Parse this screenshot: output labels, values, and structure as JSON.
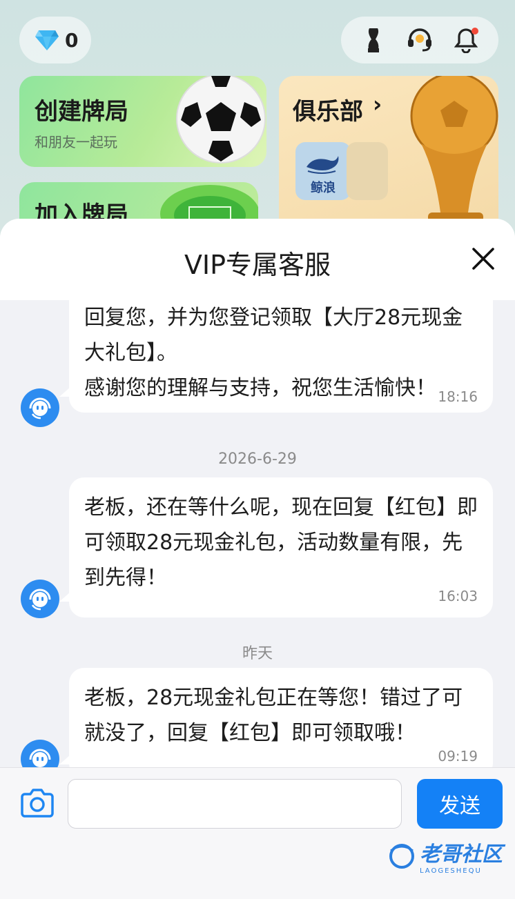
{
  "background": {
    "diamond_count": "0",
    "cards": {
      "create_title": "创建牌局",
      "create_subtitle": "和朋友一起玩",
      "join_title": "加入牌局",
      "club_title": "俱乐部",
      "club_chevron": "›",
      "club_logo_label": "鲸浪"
    },
    "toolbar_icons": [
      "trophy-icon",
      "headset-icon",
      "bell-icon"
    ]
  },
  "modal": {
    "title": "VIP专属客服",
    "close_icon": "close-icon"
  },
  "chat": {
    "messages": [
      {
        "text": "回复您，并为您登记领取【大厅28元现金大礼包】。\n感谢您的理解与支持，祝您生活愉快！",
        "time": "18:16"
      },
      {
        "date": "2026-6-29",
        "text": "老板，还在等什么呢，现在回复【红包】即可领取28元现金礼包，活动数量有限，先到先得！",
        "time": "16:03"
      },
      {
        "date": "昨天",
        "text": "老板，28元现金礼包正在等您！错过了可就没了，回复【红包】即可领取哦！",
        "time": "09:19"
      }
    ]
  },
  "input": {
    "placeholder": "",
    "value": "",
    "send_label": "发送"
  },
  "watermark": {
    "text": "老哥社区",
    "sub": "LAOGESHEQU"
  },
  "colors": {
    "accent": "#1481f6",
    "avatar": "#2d8cf0",
    "chat_bg": "#f1f2f6"
  }
}
